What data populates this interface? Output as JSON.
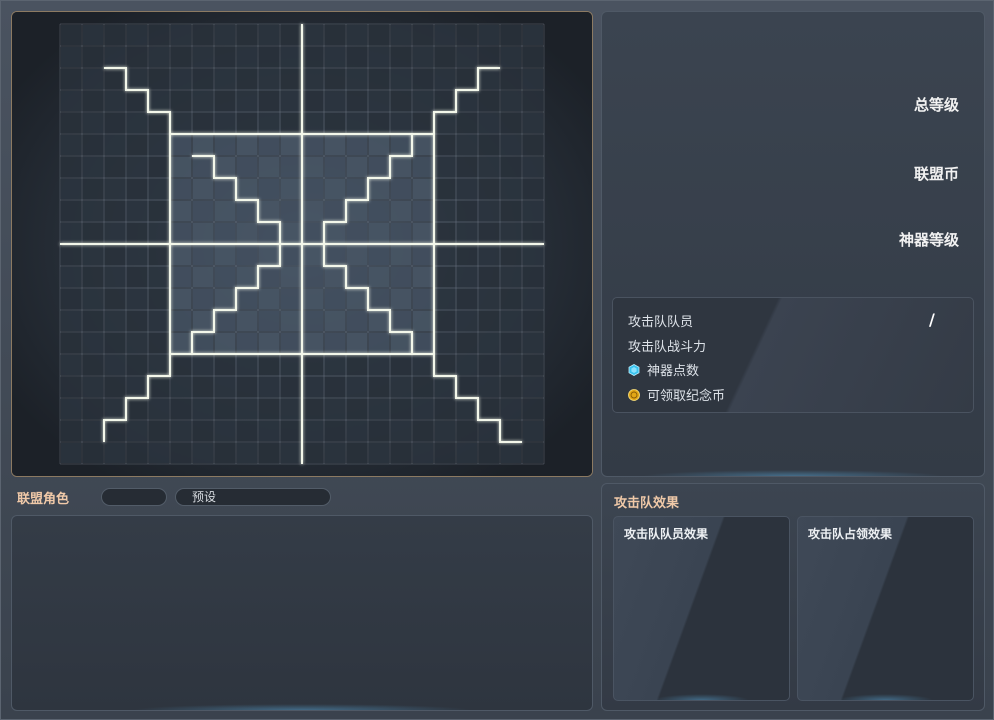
{
  "stats": {
    "total_level_label": "总等级",
    "alliance_coin_label": "联盟币",
    "artifact_level_label": "神器等级",
    "rows": {
      "members_label": "攻击队队员",
      "members_value": "/",
      "power_label": "攻击队战斗力",
      "artifact_points_label": "神器点数",
      "claimable_coins_label": "可领取纪念币"
    }
  },
  "roster": {
    "title": "联盟角色",
    "filter_value": "",
    "preset_label": "预设"
  },
  "effects": {
    "title": "攻击队效果",
    "member_effect_label": "攻击队队员效果",
    "occupy_effect_label": "攻击队占领效果"
  },
  "icons": {
    "artifact_points": "blue-hexagon-icon",
    "claimable_coins": "gold-coin-icon"
  },
  "colors": {
    "accent_title": "#f0c9a8",
    "grid_line": "#e9efe4",
    "panel_bg": "#333b46"
  }
}
